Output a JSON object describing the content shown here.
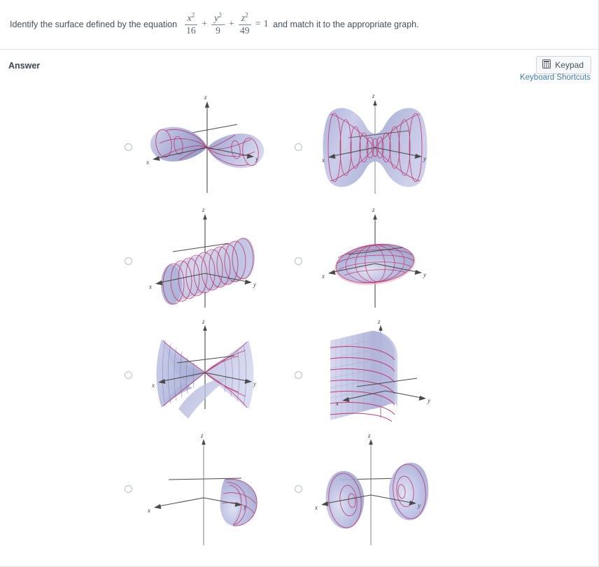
{
  "question": {
    "prefix": "Identify the surface defined by the equation ",
    "equation": {
      "terms": [
        {
          "numerator": "x",
          "exponent": "2",
          "denominator": "16"
        },
        {
          "numerator": "y",
          "exponent": "2",
          "denominator": "9"
        },
        {
          "numerator": "z",
          "exponent": "2",
          "denominator": "49"
        }
      ],
      "operators": [
        "+",
        "+"
      ],
      "relation": "=",
      "rhs": "1"
    },
    "suffix": " and match it to the appropriate graph."
  },
  "answer_section": {
    "label": "Answer",
    "keypad_button": {
      "label": "Keypad",
      "icon": "calculator-icon"
    },
    "keyboard_shortcuts_link": "Keyboard Shortcuts"
  },
  "colors": {
    "surface_fill": "#b6bbdf",
    "surface_fill_light": "#d5d8ec",
    "surface_fill_dark": "#9aa0c9",
    "curve_stroke": "#c0306b",
    "axis_stroke": "#4a4a4a",
    "link": "#3a7cb8",
    "text": "#3b4651",
    "border": "#dfe3e6",
    "radio_border": "#b9bfc5"
  },
  "choices": [
    {
      "id": "choice-1",
      "surface": "elliptic-cone",
      "selected": false,
      "axis_labels": {
        "x": "x",
        "y": "y",
        "z": "z"
      }
    },
    {
      "id": "choice-2",
      "surface": "hyperboloid-one-sheet",
      "selected": false,
      "axis_labels": {
        "x": "x",
        "y": "y",
        "z": "z"
      }
    },
    {
      "id": "choice-3",
      "surface": "circular-cylinder",
      "selected": false,
      "axis_labels": {
        "x": "x",
        "y": "y",
        "z": "z"
      }
    },
    {
      "id": "choice-4",
      "surface": "ellipsoid",
      "selected": false,
      "axis_labels": {
        "x": "x",
        "y": "y",
        "z": "z"
      }
    },
    {
      "id": "choice-5",
      "surface": "hyperbolic-paraboloid",
      "selected": false,
      "axis_labels": {
        "x": "x",
        "y": "y",
        "z": "z"
      }
    },
    {
      "id": "choice-6",
      "surface": "parabolic-cylinder",
      "selected": false,
      "axis_labels": {
        "x": "x",
        "y": "y",
        "z": "z"
      }
    },
    {
      "id": "choice-7",
      "surface": "elliptic-paraboloid",
      "selected": false,
      "axis_labels": {
        "x": "x",
        "y": "y",
        "z": "z"
      }
    },
    {
      "id": "choice-8",
      "surface": "hyperboloid-two-sheets",
      "selected": false,
      "axis_labels": {
        "x": "x",
        "y": "y",
        "z": "z"
      }
    }
  ]
}
